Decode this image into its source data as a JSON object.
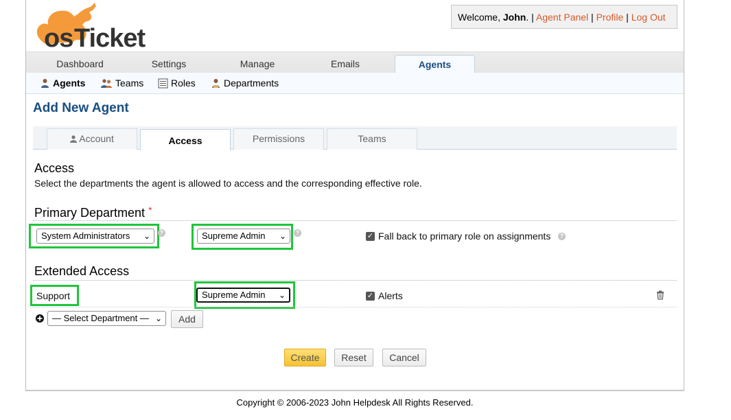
{
  "header": {
    "welcome_prefix": "Welcome, ",
    "user_name": "John",
    "welcome_suffix": ".",
    "sep1": " | ",
    "agent_panel": "Agent Panel",
    "sep2": " | ",
    "profile": "Profile",
    "sep3": " | ",
    "logout": "Log Out",
    "logo_text": "osTicket"
  },
  "nav": {
    "tabs": [
      {
        "label": "Dashboard"
      },
      {
        "label": "Settings"
      },
      {
        "label": "Manage"
      },
      {
        "label": "Emails"
      },
      {
        "label": "Agents"
      }
    ],
    "active": "Agents"
  },
  "subnav": {
    "items": [
      {
        "label": "Agents",
        "icon": "agent-icon"
      },
      {
        "label": "Teams",
        "icon": "team-icon"
      },
      {
        "label": "Roles",
        "icon": "roles-icon"
      },
      {
        "label": "Departments",
        "icon": "department-icon"
      }
    ]
  },
  "page": {
    "title": "Add New Agent",
    "tabs": [
      {
        "label": "Account",
        "icon": "user-icon"
      },
      {
        "label": "Access"
      },
      {
        "label": "Permissions"
      },
      {
        "label": "Teams"
      }
    ],
    "active_tab": "Access"
  },
  "access": {
    "heading": "Access",
    "description": "Select the departments the agent is allowed to access and the corresponding effective role.",
    "primary_heading": "Primary Department",
    "required_mark": "*",
    "primary_department": "System Administrators",
    "primary_role": "Supreme Admin",
    "fallback_label": "Fall back to primary role on assignments",
    "fallback_checked": true,
    "extended_heading": "Extended Access",
    "extended_rows": [
      {
        "department": "Support",
        "role": "Supreme Admin",
        "alerts_label": "Alerts",
        "alerts_checked": true
      }
    ],
    "add_select_placeholder": "— Select Department —",
    "add_button": "Add"
  },
  "actions": {
    "create": "Create",
    "reset": "Reset",
    "cancel": "Cancel"
  },
  "footer": {
    "copyright": "Copyright © 2006-2023 John Helpdesk All Rights Reserved."
  },
  "colors": {
    "accent_link": "#d45a28",
    "title_blue": "#184e81",
    "highlight_green": "#1fc53b",
    "primary_button": "#f5c234"
  }
}
